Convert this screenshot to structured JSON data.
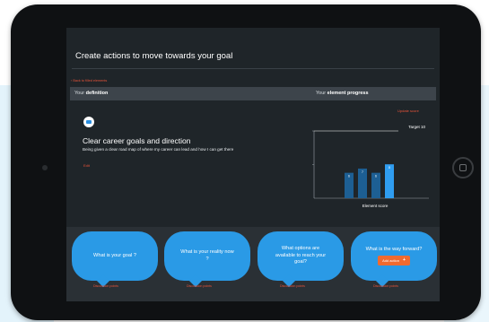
{
  "page": {
    "title": "Create actions to move towards your goal",
    "back_link": "‹ Back to filled elements"
  },
  "header": {
    "left_prefix": "Your",
    "left_bold": "definition",
    "right_prefix": "Your",
    "right_bold": "element progress"
  },
  "definition": {
    "icon": "message-card-icon",
    "title": "Clear career goals and direction",
    "description": "Being given a clear road map of where my career can lead and how I can get there",
    "edit_label": "Edit"
  },
  "progress": {
    "update_label": "Update score"
  },
  "chart_data": {
    "type": "bar",
    "categories": [
      "",
      "",
      "",
      ""
    ],
    "values": [
      6,
      7,
      6,
      8
    ],
    "data_labels": [
      "6",
      "7",
      "6",
      "8"
    ],
    "target_label": "Target 10",
    "target": 10,
    "xlabel": "Element score",
    "ylim": [
      0,
      10
    ],
    "colors": [
      "#1d5f93",
      "#1d5f93",
      "#1d5f93",
      "#2f9df0"
    ]
  },
  "cards": [
    {
      "text": "What is your goal ?",
      "link": "Discussion points"
    },
    {
      "text": "What is your reality now ?",
      "link": "Discussion points"
    },
    {
      "text": "What options are available to reach your goal?",
      "link": "Discussion points"
    },
    {
      "text": "What is the way forward?",
      "button": "Add action",
      "link": "Discussion points"
    }
  ],
  "colors": {
    "accent": "#e9543a",
    "card_blue": "#2a9ae6",
    "button_orange": "#f06a2f"
  }
}
